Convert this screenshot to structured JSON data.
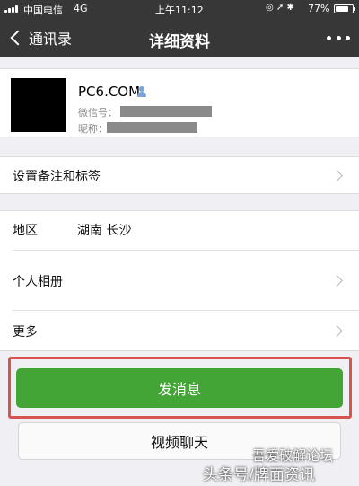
{
  "status_bar": {
    "carrier": "中国电信",
    "network": "4G",
    "time": "上午11:12",
    "battery_text": "77%",
    "battery_level": 0.77
  },
  "nav": {
    "back_label": "通讯录",
    "title": "详细资料",
    "more_icon": "more-dots-icon"
  },
  "profile": {
    "name": "PC6.COM",
    "wechat_id_label": "微信号：",
    "nickname_label": "昵称："
  },
  "cells": {
    "remark_tags": "设置备注和标签",
    "region_label": "地区",
    "region_value": "湖南 长沙",
    "album": "个人相册",
    "more": "更多"
  },
  "actions": {
    "send_message": "发消息",
    "video_call": "视频聊天"
  },
  "watermarks": {
    "forum": "吾爱破解论坛",
    "source": "头条号/牌面资讯"
  },
  "colors": {
    "nav_bg": "#373737",
    "send_button": "#43a535",
    "highlight": "#d9534f",
    "page_bg": "#efeff4"
  }
}
